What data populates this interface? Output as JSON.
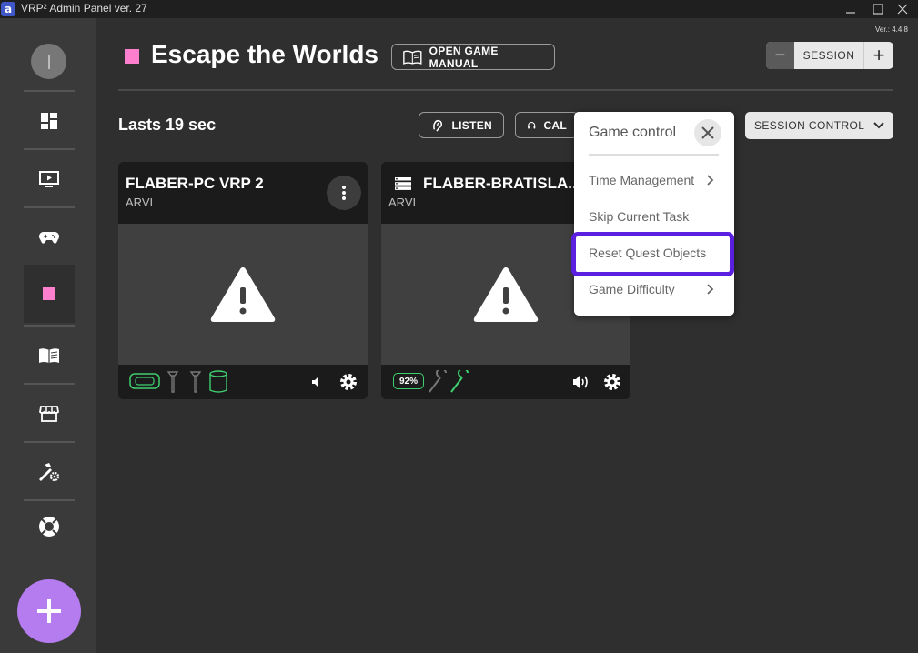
{
  "window": {
    "logo_letter": "a",
    "title": "VRP² Admin Panel ver. 27",
    "version": "Ver.: 4.4.8"
  },
  "sidebar": {
    "items": [
      {
        "icon": "dashboard-icon"
      },
      {
        "icon": "screen-play-icon"
      },
      {
        "icon": "gamepad-icon"
      },
      {
        "icon": "game-square-icon",
        "color": "#ff7fcf",
        "active": true
      },
      {
        "icon": "manual-book-icon"
      },
      {
        "icon": "store-icon"
      },
      {
        "icon": "settings-tools-icon"
      },
      {
        "icon": "support-lifebuoy-icon"
      }
    ],
    "add_icon": "plus-icon"
  },
  "header": {
    "game_color": "#ff7fcf",
    "game_title": "Escape the Worlds",
    "manual_button": "OPEN GAME MANUAL",
    "session_label": "SESSION",
    "minus": "−",
    "plus": "+"
  },
  "status": {
    "lasts": "Lasts 19 sec",
    "listen_button": "LISTEN",
    "call_button": "CAL",
    "session_control": "SESSION CONTROL"
  },
  "cards": [
    {
      "name": "FLABER-PC VRP 2",
      "subtitle": "ARVI",
      "status_icon": "warning-icon"
    },
    {
      "name": "FLABER-BRATISLA...",
      "subtitle": "ARVI",
      "status_icon": "warning-icon",
      "battery": "92%"
    }
  ],
  "menu": {
    "title": "Game control",
    "items": [
      {
        "label": "Time Management",
        "has_submenu": true
      },
      {
        "label": "Skip Current Task",
        "has_submenu": false
      },
      {
        "label": "Reset Quest Objects",
        "has_submenu": false,
        "highlighted": true
      },
      {
        "label": "Game Difficulty",
        "has_submenu": true
      }
    ],
    "highlight_color": "#5b1fe0"
  },
  "colors": {
    "background": "#2f2f2f",
    "sidebar": "#3a3a3a",
    "accent_purple": "#b57cf0",
    "device_green": "#3fcf6f"
  }
}
